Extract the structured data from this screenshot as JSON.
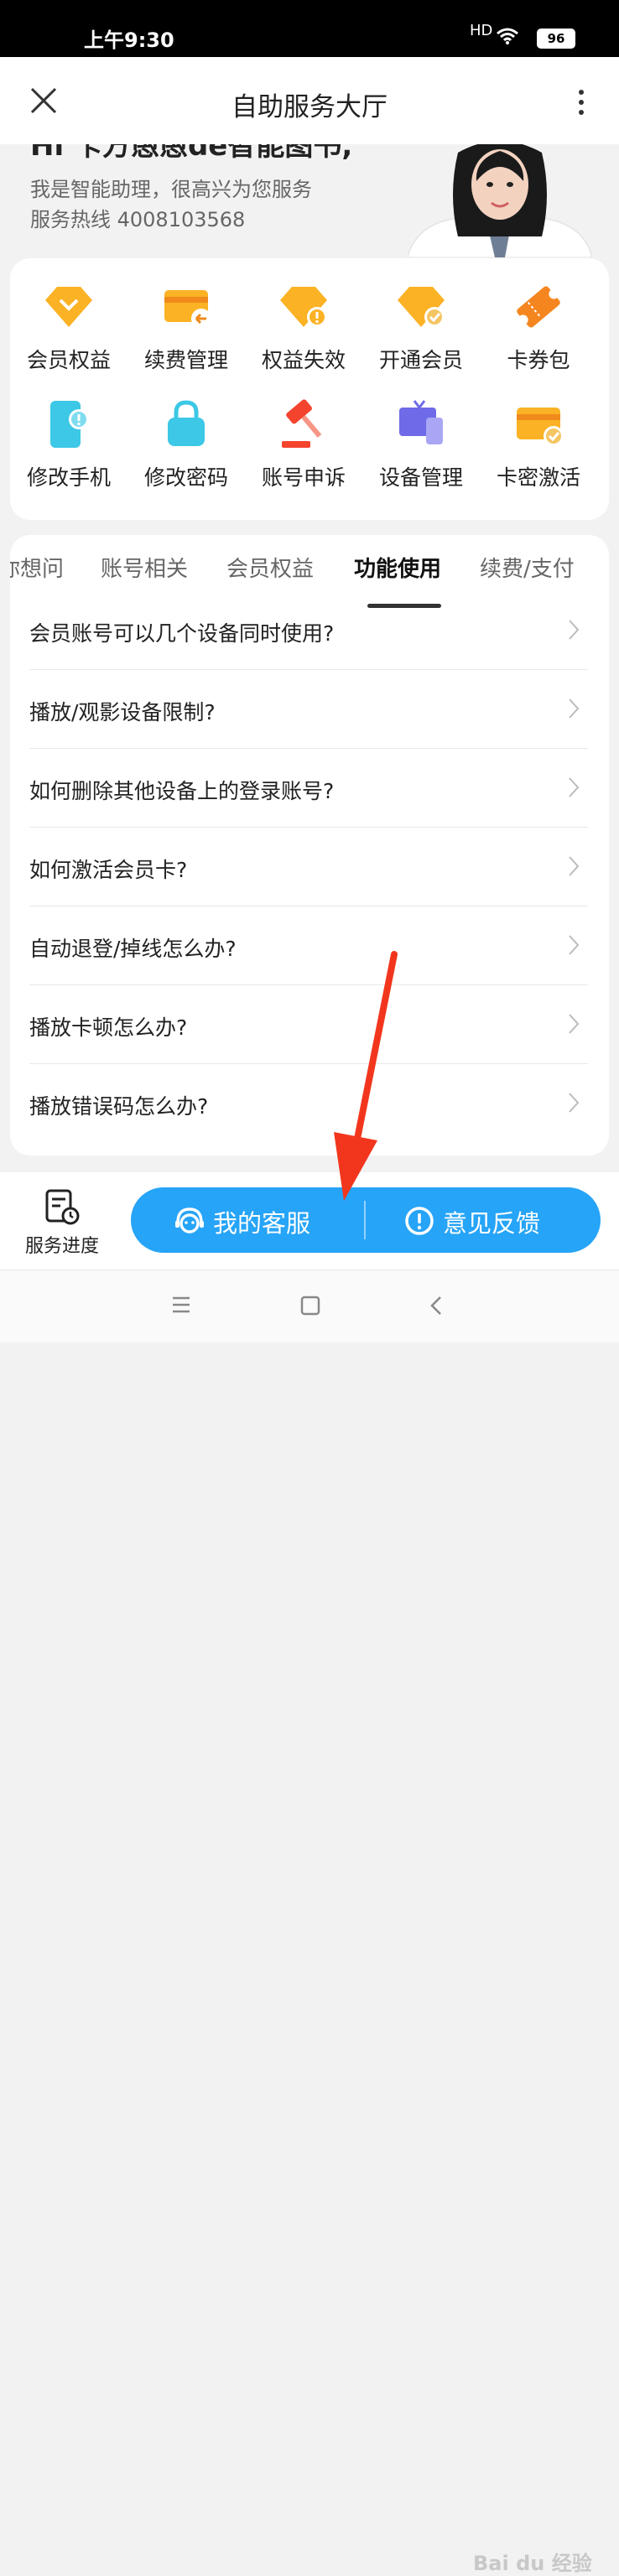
{
  "status_bar": {
    "time": "上午9:30",
    "signal": "HD",
    "battery": "96"
  },
  "header": {
    "title": "自助服务大厅"
  },
  "greeting": {
    "hi_text": "Hi 卡方愚愚de智能图书,",
    "line1": "我是智能助理，很高兴为您服务",
    "line2": "服务热线 4008103568"
  },
  "services": [
    {
      "label": "会员权益",
      "icon": "diamond-icon"
    },
    {
      "label": "续费管理",
      "icon": "card-return-icon"
    },
    {
      "label": "权益失效",
      "icon": "diamond-warning-icon"
    },
    {
      "label": "开通会员",
      "icon": "diamond-check-icon"
    },
    {
      "label": "卡券包",
      "icon": "ticket-icon"
    },
    {
      "label": "修改手机",
      "icon": "phone-warning-icon"
    },
    {
      "label": "修改密码",
      "icon": "lock-icon"
    },
    {
      "label": "账号申诉",
      "icon": "gavel-icon"
    },
    {
      "label": "设备管理",
      "icon": "devices-icon"
    },
    {
      "label": "卡密激活",
      "icon": "card-check-icon"
    }
  ],
  "tabs": [
    {
      "label": "猜你想问"
    },
    {
      "label": "账号相关"
    },
    {
      "label": "会员权益"
    },
    {
      "label": "功能使用"
    },
    {
      "label": "续费/支付"
    }
  ],
  "active_tab": "功能使用",
  "questions": [
    {
      "text": "会员账号可以几个设备同时使用?"
    },
    {
      "text": "播放/观影设备限制?"
    },
    {
      "text": "如何删除其他设备上的登录账号?"
    },
    {
      "text": "如何激活会员卡?"
    },
    {
      "text": "自动退登/掉线怎么办?"
    },
    {
      "text": "播放卡顿怎么办?"
    },
    {
      "text": "播放错误码怎么办?"
    }
  ],
  "bottom": {
    "progress_label": "服务进度",
    "customer_service_label": "我的客服",
    "feedback_label": "意见反馈"
  },
  "watermark": "Bai du 经验",
  "colors": {
    "accent_orange": "#FBB224",
    "brand_blue": "#26A4F7",
    "cyan": "#3CC8E6",
    "red": "#F4442E"
  }
}
